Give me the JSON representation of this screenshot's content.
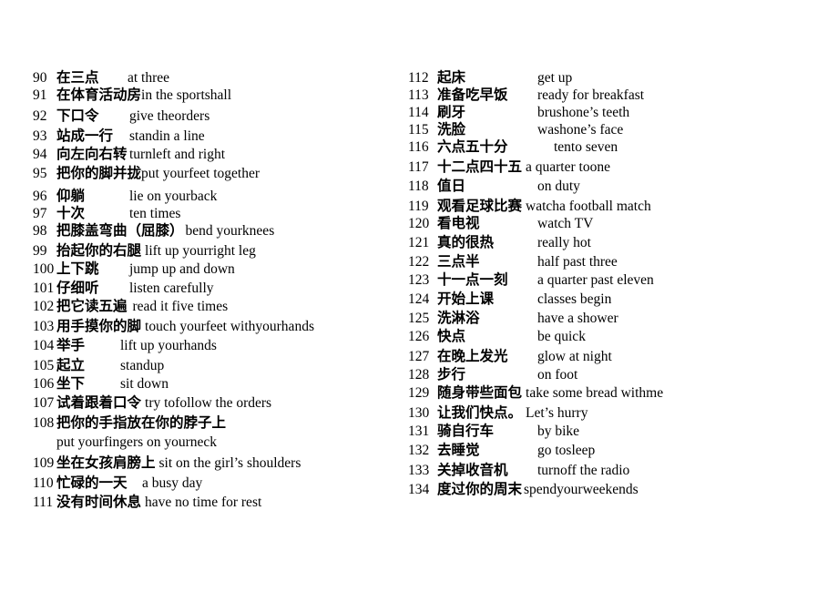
{
  "page": {
    "background": "#ffffff",
    "text_color": "#000000"
  },
  "columns": [
    {
      "name": "left-column",
      "rows": [
        {
          "num": "90",
          "zh": "在三点",
          "en": "at three",
          "zh_w": 78,
          "en_gap": 0
        },
        {
          "num": "91",
          "zh": "在体育活动房",
          "en": "in the sportshall",
          "zh_w": 78,
          "en_gap": 0
        },
        {
          "num": "92",
          "zh": "下口令",
          "en": "give theorders",
          "zh_w": 80,
          "en_gap": 0
        },
        {
          "num": "93",
          "zh": "站成一行",
          "en": "standin a line",
          "zh_w": 80,
          "en_gap": 0
        },
        {
          "num": "94",
          "zh": "向左向右转",
          "en": "turnleft and right",
          "zh_w": 80,
          "en_gap": 0
        },
        {
          "num": "95",
          "zh": "把你的脚并拢",
          "en": "put yourfeet together",
          "zh_w": 80,
          "en_gap": 0
        },
        {
          "num": "96",
          "zh": "仰躺",
          "en": "lie on yourback",
          "zh_w": 80,
          "en_gap": 0
        },
        {
          "num": "97",
          "zh": "十次",
          "en": "ten times",
          "zh_w": 80,
          "en_gap": 0
        },
        {
          "num": "98",
          "zh": "把膝盖弯曲（屈膝）",
          "en": "bend yourknees",
          "zh_w": 0,
          "en_gap": 2
        },
        {
          "num": "99",
          "zh": "抬起你的右腿",
          "en": "lift up yourright leg",
          "zh_w": 0,
          "en_gap": 4
        },
        {
          "num": "100",
          "zh": "上下跳",
          "en": "jump up and down",
          "zh_w": 80,
          "en_gap": 0
        },
        {
          "num": "101",
          "zh": "仔细听",
          "en": "listen carefully",
          "zh_w": 80,
          "en_gap": 0
        },
        {
          "num": "102",
          "zh": "把它读五遍",
          "en": "read it five times",
          "zh_w": 0,
          "en_gap": 6
        },
        {
          "num": "103",
          "zh": "用手摸你的脚",
          "en": "touch yourfeet withyourhands",
          "zh_w": 0,
          "en_gap": 4
        },
        {
          "num": "104",
          "zh": "举手",
          "en": "lift up yourhands",
          "zh_w": 70,
          "en_gap": 0
        },
        {
          "num": "105",
          "zh": "起立",
          "en": "standup",
          "zh_w": 70,
          "en_gap": 0
        },
        {
          "num": "106",
          "zh": "坐下",
          "en": "sit down",
          "zh_w": 70,
          "en_gap": 0
        },
        {
          "num": "107",
          "zh": "试着跟着口令",
          "en": "try tofollow the orders",
          "zh_w": 0,
          "en_gap": 4
        },
        {
          "num": "108",
          "zh": "把你的手指放在你的脖子上",
          "en": "",
          "zh_w": 0,
          "en_gap": 0
        },
        {
          "num": "",
          "zh": "",
          "en": "put yourfingers on yourneck",
          "zh_w": 0,
          "en_gap": 0,
          "cont": true
        },
        {
          "num": "109",
          "zh": "坐在女孩肩膀上",
          "en": "sit on the girl’s  shoulders",
          "zh_w": 0,
          "en_gap": 4
        },
        {
          "num": "110",
          "zh": "忙碌的一天",
          "en": "a busy day",
          "zh_w": 94,
          "en_gap": 0
        },
        {
          "num": "111",
          "zh": "没有时间休息",
          "en": "have no time for rest",
          "zh_w": 0,
          "en_gap": 4
        }
      ]
    },
    {
      "name": "right-column",
      "rows": [
        {
          "num": "112",
          "zh": "起床",
          "en": "get up",
          "zh_w": 110,
          "en_gap": 0
        },
        {
          "num": "113",
          "zh": "准备吃早饭",
          "en": "ready for breakfast",
          "zh_w": 110,
          "en_gap": 0
        },
        {
          "num": "114",
          "zh": "刷牙",
          "en": "brushone’s teeth",
          "zh_w": 110,
          "en_gap": 0
        },
        {
          "num": "115",
          "zh": "洗脸",
          "en": "washone’s face",
          "zh_w": 110,
          "en_gap": 0
        },
        {
          "num": "116",
          "zh": "六点五十分",
          "en": "tento seven",
          "zh_w": 110,
          "en_gap": 18
        },
        {
          "num": "117",
          "zh": "十二点四十五",
          "en": "a quarter toone",
          "zh_w": 0,
          "en_gap": 4
        },
        {
          "num": "118",
          "zh": "值日",
          "en": "on duty",
          "zh_w": 110,
          "en_gap": 0
        },
        {
          "num": "119",
          "zh": "观看足球比赛",
          "en": "watcha football match",
          "zh_w": 0,
          "en_gap": 4
        },
        {
          "num": "120",
          "zh": "看电视",
          "en": "watch TV",
          "zh_w": 110,
          "en_gap": 0
        },
        {
          "num": "121",
          "zh": "真的很热",
          "en": "really hot",
          "zh_w": 110,
          "en_gap": 0
        },
        {
          "num": "122",
          "zh": "三点半",
          "en": "half past three",
          "zh_w": 110,
          "en_gap": 0
        },
        {
          "num": "123",
          "zh": "十一点一刻",
          "en": "a quarter past eleven",
          "zh_w": 110,
          "en_gap": 0
        },
        {
          "num": "124",
          "zh": "开始上课",
          "en": "classes begin",
          "zh_w": 110,
          "en_gap": 0
        },
        {
          "num": "125",
          "zh": "洗淋浴",
          "en": "have a shower",
          "zh_w": 110,
          "en_gap": 0
        },
        {
          "num": "126",
          "zh": "快点",
          "en": "be quick",
          "zh_w": 110,
          "en_gap": 0
        },
        {
          "num": "127",
          "zh": "在晚上发光",
          "en": "glow at night",
          "zh_w": 110,
          "en_gap": 0
        },
        {
          "num": "128",
          "zh": "步行",
          "en": "on foot",
          "zh_w": 110,
          "en_gap": 0
        },
        {
          "num": "129",
          "zh": "随身带些面包",
          "en": "take some bread withme",
          "zh_w": 0,
          "en_gap": 4
        },
        {
          "num": "130",
          "zh": "让我们快点。",
          "en": "Let’s hurry",
          "zh_w": 0,
          "en_gap": 4
        },
        {
          "num": "131",
          "zh": "骑自行车",
          "en": "by bike",
          "zh_w": 110,
          "en_gap": 0
        },
        {
          "num": "132",
          "zh": "去睡觉",
          "en": "go tosleep",
          "zh_w": 110,
          "en_gap": 0
        },
        {
          "num": "133",
          "zh": "关掉收音机",
          "en": "turnoff the radio",
          "zh_w": 110,
          "en_gap": 0
        },
        {
          "num": "134",
          "zh": "度过你的周末",
          "en": "spendyourweekends",
          "zh_w": 0,
          "en_gap": 2
        }
      ]
    }
  ],
  "row_heights": {
    "left": [
      19,
      23,
      22,
      20,
      21,
      25,
      19,
      19,
      22,
      20,
      21,
      20,
      22,
      21,
      22,
      20,
      21,
      22,
      21,
      23,
      22,
      21,
      21
    ],
    "right": [
      19,
      19,
      19,
      19,
      22,
      21,
      22,
      19,
      21,
      21,
      20,
      21,
      21,
      20,
      22,
      20,
      20,
      22,
      20,
      21,
      22,
      21,
      21
    ]
  }
}
